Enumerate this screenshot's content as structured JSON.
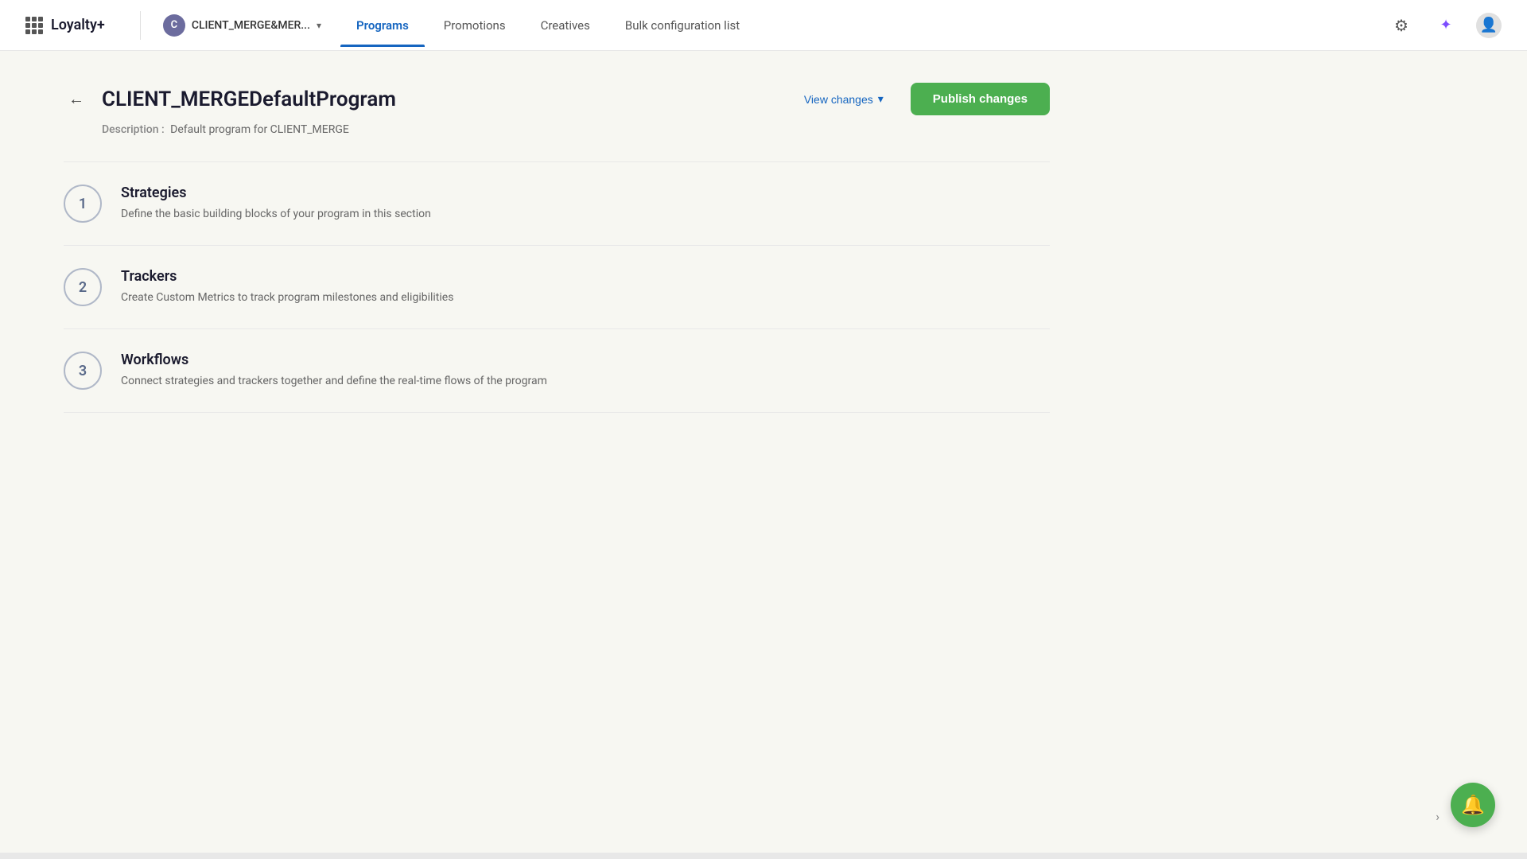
{
  "app": {
    "logo": "Loyalty+",
    "client": {
      "initial": "C",
      "name": "CLIENT_MERGE&MER..."
    }
  },
  "nav": {
    "links": [
      {
        "id": "programs",
        "label": "Programs",
        "active": true
      },
      {
        "id": "promotions",
        "label": "Promotions",
        "active": false
      },
      {
        "id": "creatives",
        "label": "Creatives",
        "active": false
      },
      {
        "id": "bulk-config",
        "label": "Bulk configuration list",
        "active": false
      }
    ]
  },
  "page": {
    "title": "CLIENT_MERGEDefaultProgram",
    "description_label": "Description :",
    "description": "Default program for CLIENT_MERGE",
    "view_changes_label": "View changes",
    "publish_label": "Publish changes"
  },
  "sections": [
    {
      "number": "1",
      "title": "Strategies",
      "description": "Define the basic building blocks of your program in this section"
    },
    {
      "number": "2",
      "title": "Trackers",
      "description": "Create Custom Metrics to track program milestones and eligibilities"
    },
    {
      "number": "3",
      "title": "Workflows",
      "description": "Connect strategies and trackers together and define the real-time flows of the program"
    }
  ],
  "icons": {
    "back_arrow": "←",
    "chevron_down": "▾",
    "gear": "⚙",
    "sparkle": "✦",
    "user": "👤",
    "bell": "🔔",
    "chevron_right": "›"
  }
}
